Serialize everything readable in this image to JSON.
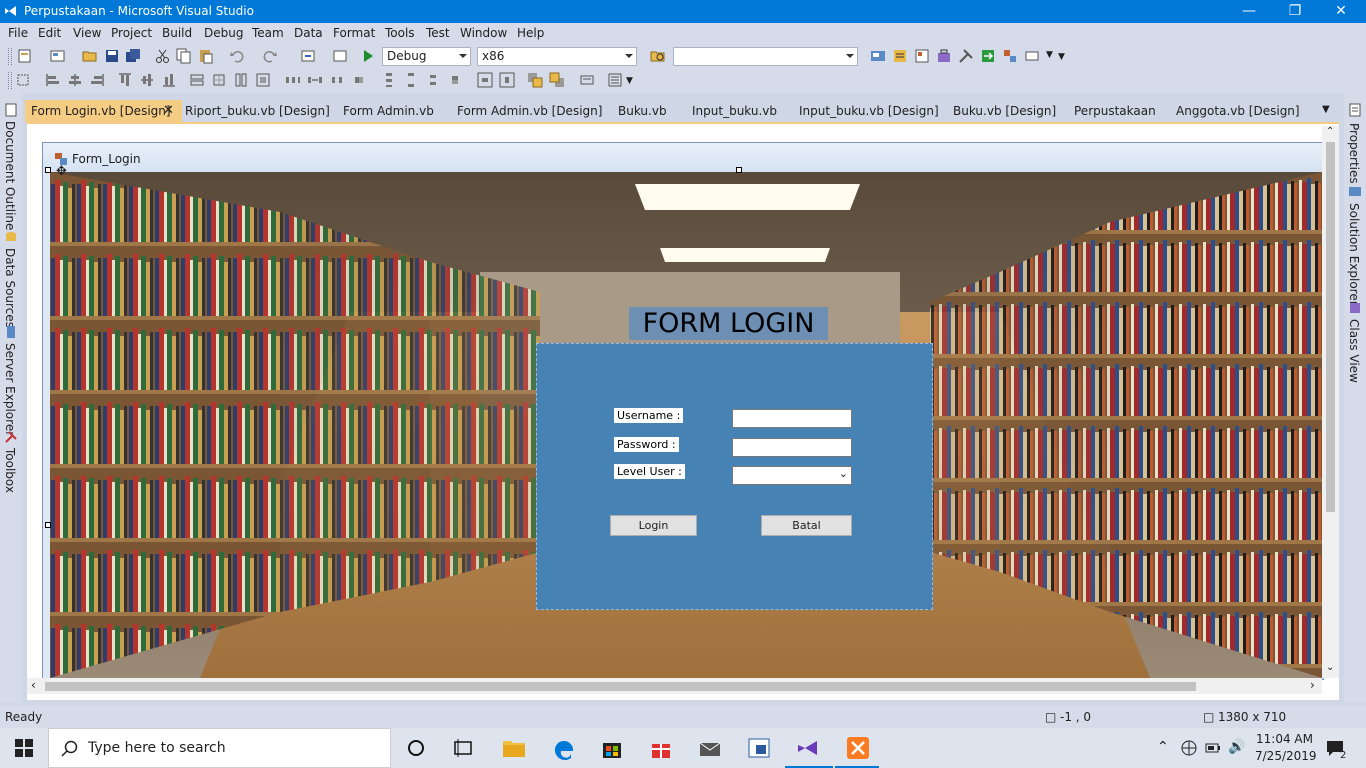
{
  "window": {
    "title": "Perpustakaan - Microsoft Visual Studio",
    "minimize_icon": "minimize-icon",
    "restore_icon": "restore-icon",
    "close_icon": "close-icon"
  },
  "menu": [
    "File",
    "Edit",
    "View",
    "Project",
    "Build",
    "Debug",
    "Team",
    "Data",
    "Format",
    "Tools",
    "Test",
    "Window",
    "Help"
  ],
  "toolbar": {
    "config": "Debug",
    "platform": "x86",
    "find": ""
  },
  "side_left": [
    "Document Outline",
    "Data Sources",
    "Server Explorer",
    "Toolbox"
  ],
  "side_right": [
    "Properties",
    "Solution Explorer",
    "Class View"
  ],
  "tabs": [
    "Form Login.vb [Design]",
    "Riport_buku.vb [Design]",
    "Form Admin.vb",
    "Form Admin.vb [Design]",
    "Buku.vb",
    "Input_buku.vb",
    "Input_buku.vb [Design]",
    "Buku.vb [Design]",
    "Perpustakaan",
    "Anggota.vb [Design]"
  ],
  "form": {
    "caption": "Form_Login",
    "heading": "FORM LOGIN",
    "username_label": "Username :",
    "password_label": "Password :",
    "level_label": "Level User :",
    "username_value": "",
    "password_value": "",
    "level_value": "",
    "login_button": "Login",
    "cancel_button": "Batal"
  },
  "status": {
    "text": "Ready",
    "position": "-1 , 0",
    "size": "1380 x 710"
  },
  "taskbar": {
    "search_placeholder": "Type here to search",
    "time": "11:04 AM",
    "date": "7/25/2019",
    "notifications": "2"
  },
  "colors": {
    "titlebar": "#0078d7",
    "panel": "#4682b4",
    "active_tab": "#f5cc84"
  }
}
